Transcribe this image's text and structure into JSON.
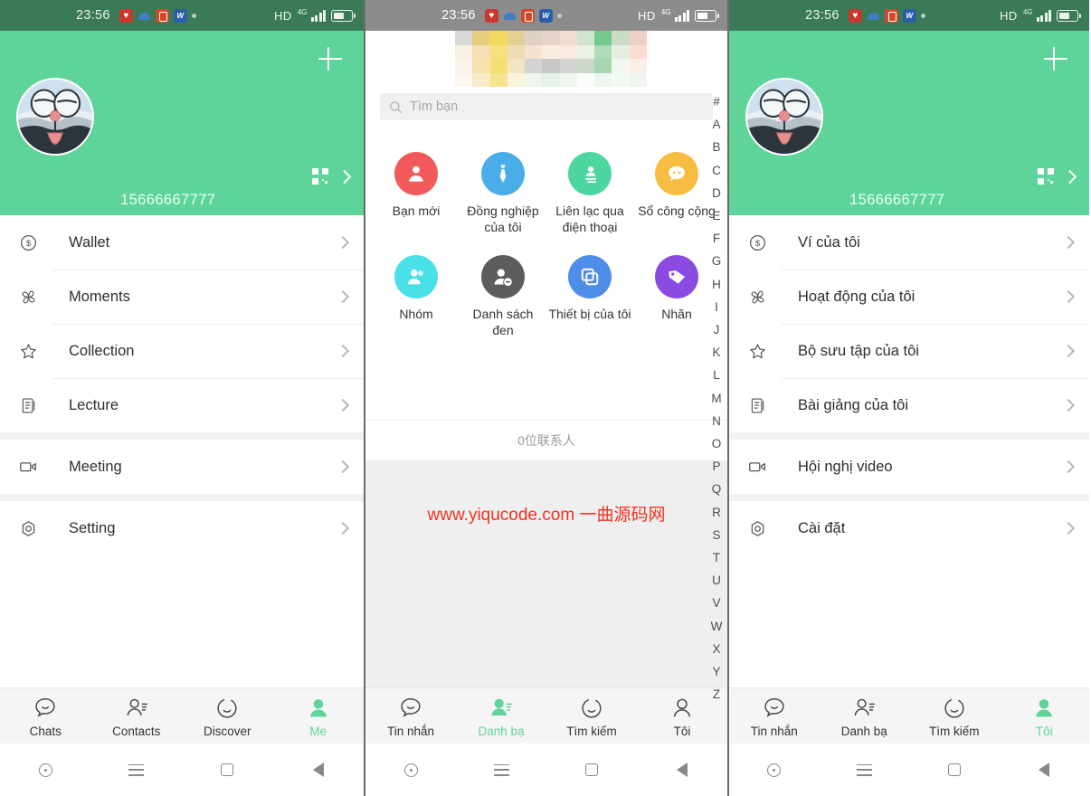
{
  "statusbar": {
    "time": "23:56",
    "hd_label": "HD",
    "net_label": "4G",
    "icons": [
      "heart-app-icon",
      "cloud-app-icon",
      "orange-app-icon",
      "blue-app-icon",
      "dot-indicator-icon"
    ]
  },
  "colors": {
    "brand_green": "#5fd49a",
    "status_green": "#3a7a56",
    "status_gray": "#8c8c8c",
    "watermark_red": "#f4301e",
    "new_friend": "#f2595b",
    "colleague": "#4aade8",
    "phone_contact": "#4ed6a0",
    "public_account": "#f7bd42",
    "group": "#4ae0e8",
    "blacklist": "#5c5c5c",
    "my_device": "#4f8ee8",
    "tag": "#8b4be0"
  },
  "screen1": {
    "profile": {
      "phone_number": "15666667777",
      "add_button": "add-button",
      "qr_icon": "qr-code-icon",
      "avatar_alt": "cartoon-cat-avatar"
    },
    "menu_groups": [
      [
        {
          "icon": "dollar-circle-icon",
          "label": "Wallet"
        },
        {
          "icon": "pinwheel-icon",
          "label": "Moments"
        },
        {
          "icon": "star-icon",
          "label": "Collection"
        },
        {
          "icon": "document-icon",
          "label": "Lecture"
        }
      ],
      [
        {
          "icon": "video-camera-icon",
          "label": "Meeting"
        }
      ],
      [
        {
          "icon": "gear-icon",
          "label": "Setting"
        }
      ]
    ],
    "tabs": [
      {
        "icon": "chat-bubble-icon",
        "label": "Chats",
        "active": false
      },
      {
        "icon": "contacts-icon",
        "label": "Contacts",
        "active": false
      },
      {
        "icon": "discover-icon",
        "label": "Discover",
        "active": false
      },
      {
        "icon": "person-icon",
        "label": "Me",
        "active": true
      }
    ]
  },
  "screen2": {
    "search": {
      "placeholder": "Tìm bạn",
      "icon": "search-icon"
    },
    "grid": [
      {
        "icon": "new-friend-icon",
        "label": "Bạn mới",
        "color": "#f2595b"
      },
      {
        "icon": "necktie-icon",
        "label": "Đồng nghiệp của tôi",
        "color": "#4aade8"
      },
      {
        "icon": "contact-card-icon",
        "label": "Liên lạc qua điện thoại",
        "color": "#4ed6a0"
      },
      {
        "icon": "chat-bubble-icon",
        "label": "Sổ công cộng",
        "color": "#f7bd42"
      },
      {
        "icon": "group-icon",
        "label": "Nhóm",
        "color": "#4ae0e8"
      },
      {
        "icon": "blocked-user-icon",
        "label": "Danh sách đen",
        "color": "#5c5c5c"
      },
      {
        "icon": "devices-icon",
        "label": "Thiết bị của tôi",
        "color": "#4f8ee8"
      },
      {
        "icon": "tag-icon",
        "label": "Nhãn",
        "color": "#8b4be0"
      }
    ],
    "contact_count": "0位联系人",
    "watermark": "www.yiqucode.com 一曲源码网",
    "alpha_index": [
      "#",
      "A",
      "B",
      "C",
      "D",
      "E",
      "F",
      "G",
      "H",
      "I",
      "J",
      "K",
      "L",
      "M",
      "N",
      "O",
      "P",
      "Q",
      "R",
      "S",
      "T",
      "U",
      "V",
      "W",
      "X",
      "Y",
      "Z"
    ],
    "tabs": [
      {
        "icon": "chat-bubble-icon",
        "label": "Tin nhắn",
        "active": false
      },
      {
        "icon": "contacts-icon",
        "label": "Danh bạ",
        "active": true
      },
      {
        "icon": "discover-icon",
        "label": "Tìm kiếm",
        "active": false
      },
      {
        "icon": "person-icon",
        "label": "Tôi",
        "active": false
      }
    ]
  },
  "screen3": {
    "profile": {
      "phone_number": "15666667777",
      "add_button": "add-button",
      "qr_icon": "qr-code-icon",
      "avatar_alt": "cartoon-cat-avatar"
    },
    "menu_groups": [
      [
        {
          "icon": "dollar-circle-icon",
          "label": "Ví của tôi"
        },
        {
          "icon": "pinwheel-icon",
          "label": "Hoạt động của tôi"
        },
        {
          "icon": "star-icon",
          "label": "Bộ sưu tập của tôi"
        },
        {
          "icon": "document-icon",
          "label": "Bài giảng của tôi"
        }
      ],
      [
        {
          "icon": "video-camera-icon",
          "label": "Hội nghị video"
        }
      ],
      [
        {
          "icon": "gear-icon",
          "label": "Cài đặt"
        }
      ]
    ],
    "tabs": [
      {
        "icon": "chat-bubble-icon",
        "label": "Tin nhắn",
        "active": false
      },
      {
        "icon": "contacts-icon",
        "label": "Danh bạ",
        "active": false
      },
      {
        "icon": "discover-icon",
        "label": "Tìm kiếm",
        "active": false
      },
      {
        "icon": "person-icon",
        "label": "Tôi",
        "active": true
      }
    ]
  }
}
